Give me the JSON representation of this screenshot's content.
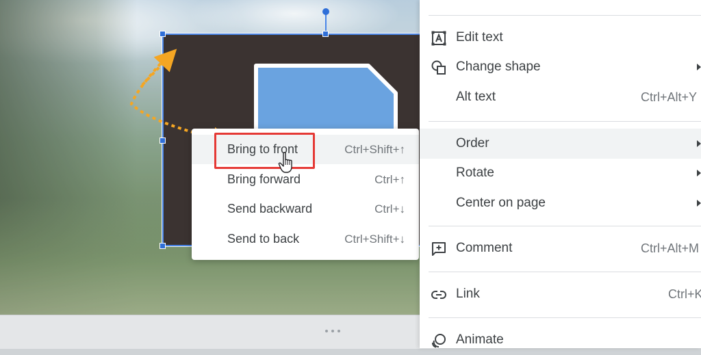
{
  "context_menu": {
    "items": [
      {
        "label": "Edit text",
        "shortcut": "",
        "icon": "edit-text-icon",
        "submenu": false
      },
      {
        "label": "Change shape",
        "shortcut": "",
        "icon": "change-shape-icon",
        "submenu": true
      },
      {
        "label": "Alt text",
        "shortcut": "Ctrl+Alt+Y",
        "icon": "",
        "submenu": false
      },
      {
        "label": "Order",
        "shortcut": "",
        "icon": "",
        "submenu": true,
        "active": true
      },
      {
        "label": "Rotate",
        "shortcut": "",
        "icon": "",
        "submenu": true
      },
      {
        "label": "Center on page",
        "shortcut": "",
        "icon": "",
        "submenu": true
      },
      {
        "label": "Comment",
        "shortcut": "Ctrl+Alt+M",
        "icon": "comment-icon",
        "submenu": false
      },
      {
        "label": "Link",
        "shortcut": "Ctrl+K",
        "icon": "link-icon",
        "submenu": false
      },
      {
        "label": "Animate",
        "shortcut": "",
        "icon": "animate-icon",
        "submenu": false
      }
    ]
  },
  "order_submenu": {
    "items": [
      {
        "label": "Bring to front",
        "shortcut": "Ctrl+Shift+↑",
        "hover": true
      },
      {
        "label": "Bring forward",
        "shortcut": "Ctrl+↑"
      },
      {
        "label": "Send backward",
        "shortcut": "Ctrl+↓"
      },
      {
        "label": "Send to back",
        "shortcut": "Ctrl+Shift+↓"
      }
    ]
  },
  "colors": {
    "selection": "#4a86e8",
    "shape_fill": "#3b3331",
    "inner_shape_fill": "#6aa3e0",
    "highlight": "#e53935",
    "annotation_arrow": "#f5a623"
  }
}
